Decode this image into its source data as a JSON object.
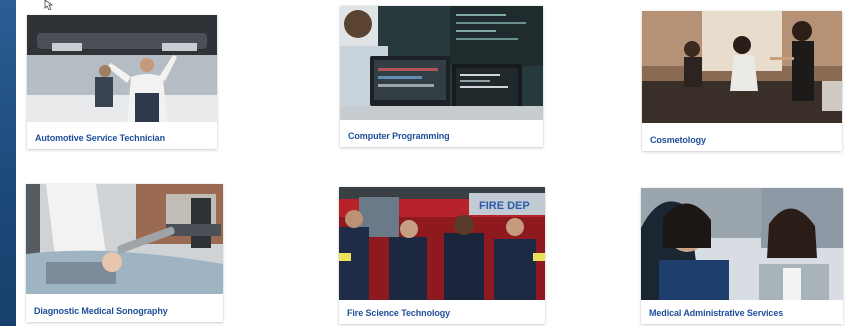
{
  "programs": [
    {
      "label": "Automotive Service Technician",
      "image": "mechanic-under-car-photo"
    },
    {
      "label": "Computer Programming",
      "image": "programmer-laptops-photo"
    },
    {
      "label": "Cosmetology",
      "image": "salon-stylists-photo"
    },
    {
      "label": "Diagnostic Medical Sonography",
      "image": "ultrasound-exam-photo"
    },
    {
      "label": "Fire Science Technology",
      "image": "firefighters-truck-photo"
    },
    {
      "label": "Medical Administrative Services",
      "image": "medical-staff-smiling-photo"
    }
  ],
  "cursor_icon": "mouse-pointer-icon",
  "truck_text": "FIRE DEP"
}
